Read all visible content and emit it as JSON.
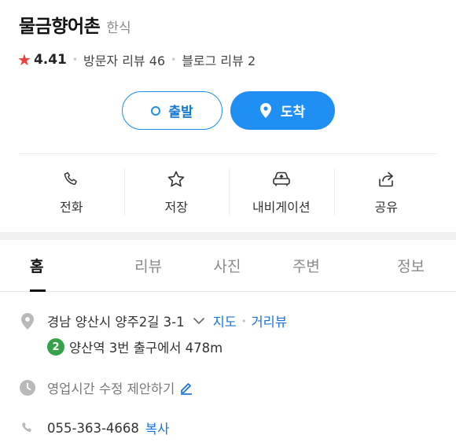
{
  "place": {
    "name": "물금향어촌",
    "category": "한식",
    "rating_star": "★",
    "rating": "4.41",
    "visitor_reviews": "방문자 리뷰 46",
    "blog_reviews": "블로그 리뷰 2"
  },
  "route": {
    "depart_label": "출발",
    "arrive_label": "도착"
  },
  "actions": [
    {
      "label": "전화",
      "icon": "phone-icon"
    },
    {
      "label": "저장",
      "icon": "star-outline-icon"
    },
    {
      "label": "내비게이션",
      "icon": "car-navigation-icon"
    },
    {
      "label": "공유",
      "icon": "share-icon"
    }
  ],
  "tabs": [
    {
      "label": "홈",
      "active": true
    },
    {
      "label": "리뷰"
    },
    {
      "label": "사진"
    },
    {
      "label": "주변"
    },
    {
      "label": "정보"
    }
  ],
  "info": {
    "address": "경남 양산시 양주2길 3-1",
    "map_link": "지도",
    "street_view_link": "거리뷰",
    "subway_line": "2",
    "subway_text": "양산역 3번 출구에서 478m",
    "hours_text": "영업시간 수정 제안하기",
    "phone": "055-363-4668",
    "copy_label": "복사"
  },
  "colors": {
    "accent": "#1f8ff3",
    "star": "#f23b3b",
    "subway_line_2": "#33a24a",
    "link": "#1a73d9"
  }
}
